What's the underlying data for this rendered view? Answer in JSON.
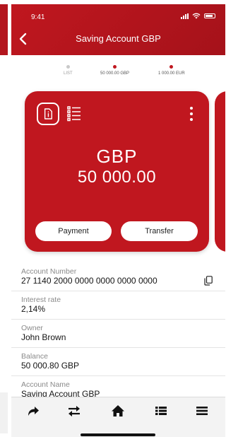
{
  "status_bar": {
    "time": "9:41"
  },
  "header": {
    "title": "Saving Account GBP",
    "back_icon": "chevron-left-icon"
  },
  "pager": {
    "items": [
      {
        "label": "LIST",
        "active": false
      },
      {
        "label": "50 000.00 GBP",
        "active": true
      },
      {
        "label": "1 000.00 EUR",
        "active": true
      }
    ]
  },
  "card": {
    "currency": "GBP",
    "amount": "50 000.00",
    "payment_label": "Payment",
    "transfer_label": "Transfer",
    "color": "#c0171f",
    "icons": [
      "document-icon",
      "list-icon",
      "more-vertical-icon"
    ]
  },
  "details": [
    {
      "label": "Account Number",
      "value": "27 1140 2000 0000 0000 0000 0000",
      "copy": true
    },
    {
      "label": "Interest rate",
      "value": "2,14%"
    },
    {
      "label": "Owner",
      "value": "John Brown"
    },
    {
      "label": "Balance",
      "value": "50 000.80 GBP"
    },
    {
      "label": "Account Name",
      "value": "Saving Account GBP"
    }
  ],
  "bottom_nav": {
    "items": [
      "share-arrow-icon",
      "transfer-arrows-icon",
      "home-icon",
      "list-icon",
      "menu-icon"
    ]
  }
}
